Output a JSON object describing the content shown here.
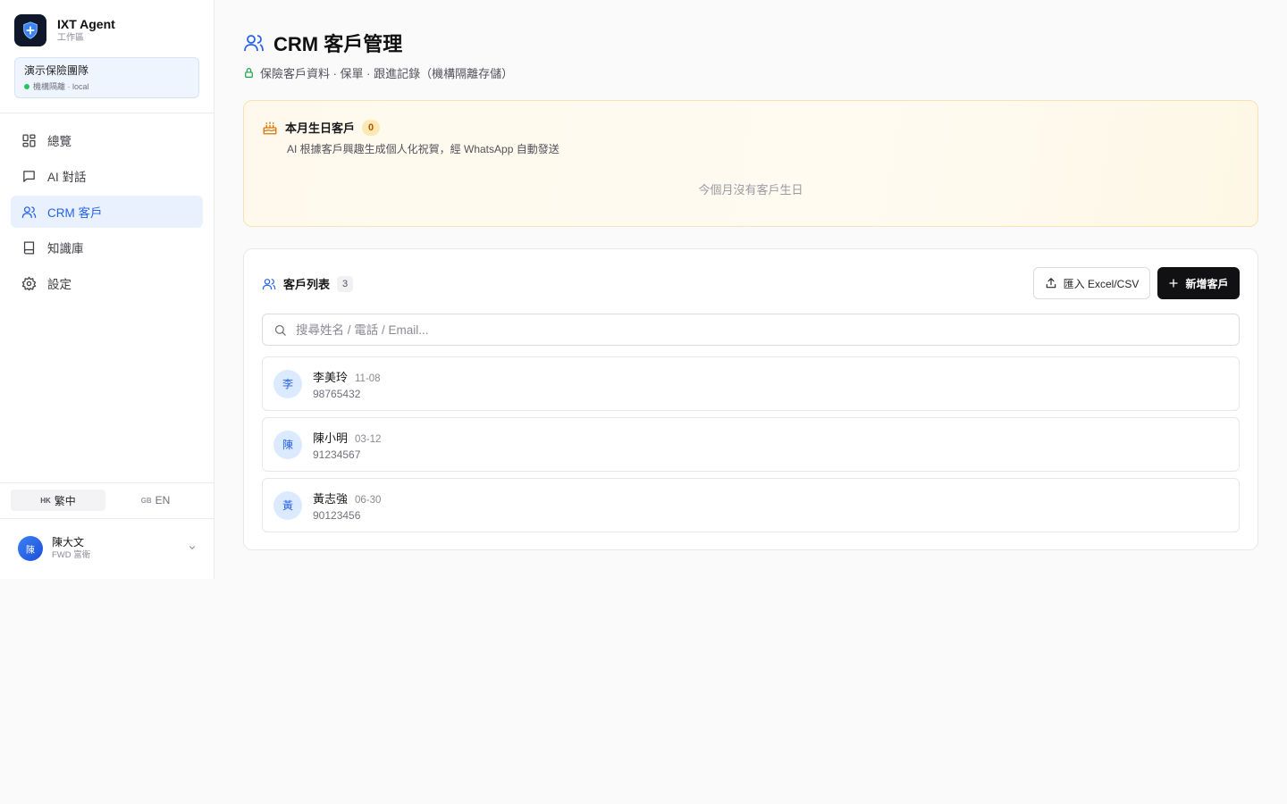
{
  "brand": {
    "name": "IXT Agent",
    "sub": "工作區"
  },
  "team": {
    "name": "演示保險團隊",
    "status": "機構隔離 · local"
  },
  "nav": [
    {
      "label": "總覽",
      "icon": "dashboard-icon"
    },
    {
      "label": "AI 對話",
      "icon": "chat-icon"
    },
    {
      "label": "CRM 客戶",
      "icon": "users-icon",
      "active": true
    },
    {
      "label": "知識庫",
      "icon": "book-icon"
    },
    {
      "label": "設定",
      "icon": "gear-icon"
    }
  ],
  "lang": {
    "zh": {
      "flag": "HK",
      "label": "繁中",
      "active": true
    },
    "en": {
      "flag": "GB",
      "label": "EN"
    }
  },
  "user": {
    "avatar": "陳",
    "name": "陳大文",
    "org": "FWD 富衛"
  },
  "page": {
    "title": "CRM 客戶管理",
    "subtitle": "保險客戶資料 · 保單 · 跟進記錄（機構隔離存儲）"
  },
  "birthday": {
    "title": "本月生日客戶",
    "count": "0",
    "desc": "AI 根據客戶興趣生成個人化祝賀，經 WhatsApp 自動發送",
    "empty": "今個月沒有客戶生日"
  },
  "customers": {
    "title": "客戶列表",
    "count": "3",
    "import_label": "匯入 Excel/CSV",
    "add_label": "新增客戶",
    "search_placeholder": "搜尋姓名 / 電話 / Email...",
    "rows": [
      {
        "avatar": "李",
        "name": "李美玲",
        "date": "11-08",
        "phone": "98765432"
      },
      {
        "avatar": "陳",
        "name": "陳小明",
        "date": "03-12",
        "phone": "91234567"
      },
      {
        "avatar": "黃",
        "name": "黃志強",
        "date": "06-30",
        "phone": "90123456"
      }
    ]
  },
  "colors": {
    "accent": "#2563eb",
    "primary_button": "#111114",
    "birthday_bg": "#fef9ec",
    "status_green": "#22c55e"
  }
}
